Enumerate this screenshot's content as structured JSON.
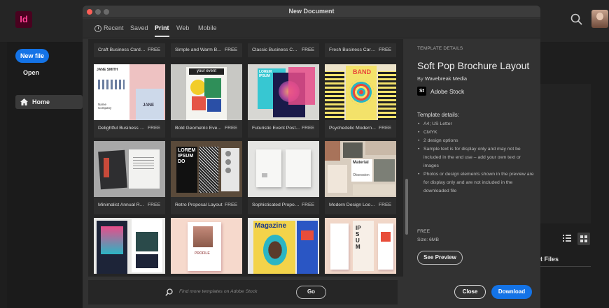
{
  "app": {
    "logo": "Id",
    "new_file": "New file",
    "open": "Open",
    "home": "Home",
    "files_label": "t Files"
  },
  "dialog": {
    "title": "New Document",
    "tabs": [
      "Recent",
      "Saved",
      "Print",
      "Web",
      "Mobile"
    ],
    "active_tab": "Print"
  },
  "templates": {
    "top_row": [
      {
        "label": "Craft Business Card L...",
        "price": "FREE"
      },
      {
        "label": "Simple and Warm B...",
        "price": "FREE"
      },
      {
        "label": "Classic Business Card...",
        "price": "FREE"
      },
      {
        "label": "Fresh Business Card...",
        "price": "FREE"
      }
    ],
    "row1": [
      {
        "label": "Delightful Business C...",
        "price": "FREE"
      },
      {
        "label": "Bold Geometric Eve...",
        "price": "FREE"
      },
      {
        "label": "Futuristic Event Post...",
        "price": "FREE"
      },
      {
        "label": "Psychedelic Modern...",
        "price": "FREE"
      }
    ],
    "row2": [
      {
        "label": "Minimalist Annual R...",
        "price": "FREE"
      },
      {
        "label": "Retro Proposal Layout",
        "price": "FREE"
      },
      {
        "label": "Sophisticated Propos...",
        "price": "FREE"
      },
      {
        "label": "Modern Design Look...",
        "price": "FREE"
      }
    ],
    "thumb_text": {
      "jane_smith": "JANE SMITH",
      "jane": "JANE",
      "company": "Name Company",
      "your_event": "your event",
      "lorem_ipsum": "LOREM IPSUM",
      "band": "BAND",
      "retro": "LOREM IPSUM DO",
      "material": "Material",
      "obsession": "Obsession",
      "magazine": "Magazine",
      "profile": "PROFILE",
      "ipsum": "IPSUM"
    }
  },
  "search": {
    "placeholder": "Find more templates on Adobe Stock",
    "go": "Go"
  },
  "details": {
    "heading": "TEMPLATE DETAILS",
    "title": "Soft Pop Brochure Layout",
    "by_prefix": "By",
    "author": "Wavebreak Media",
    "stock_badge": "St",
    "stock_name": "Adobe Stock",
    "sub_heading": "Template details:",
    "items": [
      "A4; US Letter",
      "CMYK",
      "2 design options",
      "Sample text is for display only and may not be included in the end use – add your own text or images",
      "Photos or design elements shown in the preview are for display only and are not included in the downloaded file"
    ],
    "price": "FREE",
    "size": "Size: 6MB",
    "see_preview": "See Preview"
  },
  "buttons": {
    "close": "Close",
    "download": "Download"
  },
  "colors": {
    "accent": "#1473e6",
    "dialog_bg": "#323232",
    "app_bg": "#1e1e1e"
  }
}
